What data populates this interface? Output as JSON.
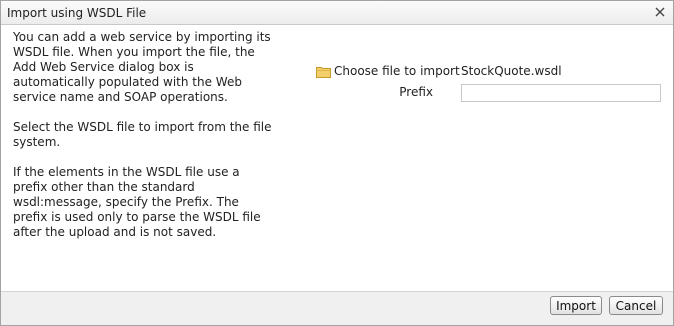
{
  "dialog": {
    "title": "Import using WSDL File",
    "close_icon": "close-icon"
  },
  "help": {
    "paragraphs": [
      "You can add a web service by importing its WSDL file. When you import the file, the Add Web Service dialog box is automatically populated with the Web service name and SOAP operations.",
      "Select the WSDL file to import from the file system.",
      "If the elements in the WSDL file use a prefix other than the standard wsdl:message, specify the Prefix. The prefix is used only to parse the WSDL file after the upload and is not saved."
    ]
  },
  "form": {
    "choose_file_label": "Choose file to import",
    "folder_icon": "folder-icon",
    "file_name": "StockQuote.wsdl",
    "prefix_label": "Prefix",
    "prefix_value": ""
  },
  "footer": {
    "import_label": "Import",
    "cancel_label": "Cancel"
  }
}
